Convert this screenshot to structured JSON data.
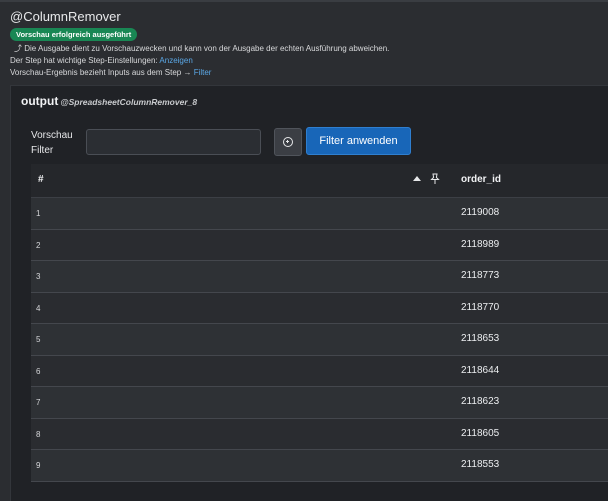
{
  "header": {
    "title": "@ColumnRemover",
    "badge": "Vorschau erfolgreich ausgeführt",
    "info_icon": "return-arrow-icon",
    "info_text": "Die Ausgabe dient zu Vorschauzwecken und kann von der Ausgabe der echten Ausführung abweichen.",
    "settings_text": "Der Step hat wichtige Step-Einstellungen:",
    "settings_link": "Anzeigen",
    "inputs_text": "Vorschau-Ergebnis bezieht Inputs aus dem Step",
    "inputs_arrow": "→",
    "inputs_link": "Filter",
    "badge_color": "#198754",
    "link_color": "#5aa7e6"
  },
  "panel": {
    "output_label": "output",
    "output_source": "@SpreadsheetColumnRemover_8"
  },
  "filter": {
    "label_line1": "Vorschau",
    "label_line2": "Filter",
    "value": "",
    "placeholder": "",
    "add_icon": "plus-circle-icon",
    "apply_label": "Filter anwenden",
    "apply_color": "#1866b8"
  },
  "table": {
    "columns": [
      "#",
      "order_id"
    ],
    "sort_icon": "sort-up-icon",
    "pin_icon": "pin-icon",
    "rows": [
      {
        "num": "1",
        "order_id": "2119008"
      },
      {
        "num": "2",
        "order_id": "2118989"
      },
      {
        "num": "3",
        "order_id": "2118773"
      },
      {
        "num": "4",
        "order_id": "2118770"
      },
      {
        "num": "5",
        "order_id": "2118653"
      },
      {
        "num": "6",
        "order_id": "2118644"
      },
      {
        "num": "7",
        "order_id": "2118623"
      },
      {
        "num": "8",
        "order_id": "2118605"
      },
      {
        "num": "9",
        "order_id": "2118553"
      }
    ]
  }
}
